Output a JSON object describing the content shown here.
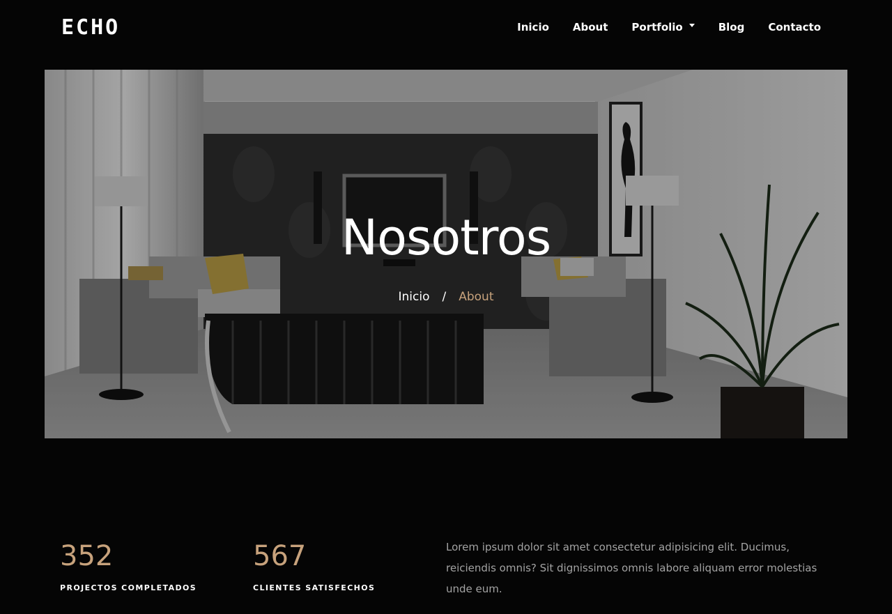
{
  "brand": {
    "logo_text": "ECHO"
  },
  "nav": {
    "items": [
      {
        "label": "Inicio"
      },
      {
        "label": "About"
      },
      {
        "label": "Portfolio",
        "has_dropdown": true
      },
      {
        "label": "Blog"
      },
      {
        "label": "Contacto"
      }
    ]
  },
  "hero": {
    "title": "Nosotros",
    "breadcrumb": {
      "home": "Inicio",
      "separator": "/",
      "current": "About"
    }
  },
  "stats": [
    {
      "number": "352",
      "label": "PROJECTOS COMPLETADOS"
    },
    {
      "number": "567",
      "label": "CLIENTES SATISFECHOS"
    }
  ],
  "about": {
    "text": "Lorem ipsum dolor sit amet consectetur adipisicing elit. Ducimus, reiciendis omnis? Sit dignissimos omnis labore aliquam error molestias unde eum."
  },
  "colors": {
    "accent": "#c7a27c",
    "background": "#050505",
    "muted_text": "#a3a3a3"
  }
}
